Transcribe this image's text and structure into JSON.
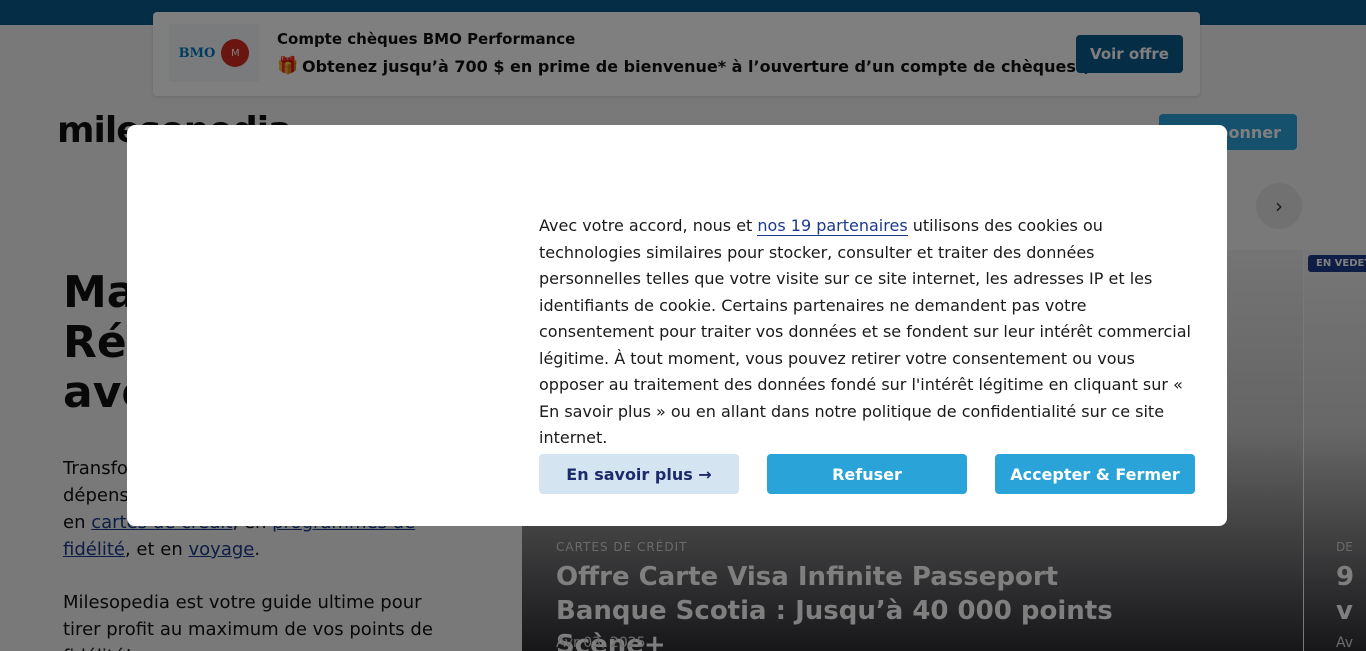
{
  "promo": {
    "logo_text": "BMO",
    "logo_mark": "M",
    "title": "Compte chèques BMO Performance",
    "text": "Obtenez jusqu’à 700 $ en prime de bienvenue* à l’ouverture d’un compte de chèques.†",
    "button": "Voir offre"
  },
  "header": {
    "logo": "milesopedia",
    "subscribe_label": "S'abonner"
  },
  "hero": {
    "title_lines": [
      "Ma",
      "Réa",
      "ave"
    ],
    "p1_start": "Transfo",
    "p1_line2": "dépens",
    "p1_line3_prefix": "en ",
    "link_cartes": "cartes de crédit",
    "p1_sep": ", en ",
    "link_programmes": "programmes de fidélité",
    "p1_mid": ", et en ",
    "link_voyage": "voyage",
    "p1_end": ".",
    "p2": "Milesopedia est votre guide ultime pour tirer profit au maximum de vos points de fidélité!"
  },
  "featured": {
    "badge": "EN VEDETTE",
    "category": "CARTES DE CRÉDIT",
    "title": "Offre Carte Visa Infinite Passeport Banque Scotia : Jusqu’à 40 000 points Scène+",
    "date": "Avr 03, 2025"
  },
  "next_card": {
    "category": "DE",
    "title_line1": "9",
    "title_line2": "v",
    "date": "Av"
  },
  "consent": {
    "text_before": "Avec votre accord, nous et ",
    "partners_link": "nos 19 partenaires",
    "text_after": " utilisons des cookies ou technologies similaires pour stocker, consulter et traiter des données personnelles telles que votre visite sur ce site internet, les adresses IP et les identifiants de cookie. Certains partenaires ne demandent pas votre consentement pour traiter vos données et se fondent sur leur intérêt commercial légitime. À tout moment, vous pouvez retirer votre consentement ou vous opposer au traitement des données fondé sur l'intérêt légitime en cliquant sur « En savoir plus » ou en allant dans notre politique de confidentialité sur ce site internet.",
    "learn_more": "En savoir plus →",
    "refuse": "Refuser",
    "accept": "Accepter & Fermer"
  },
  "icons": {
    "gift": "gift-icon",
    "search": "search-icon",
    "chevron": "chevron-right-icon"
  },
  "colors": {
    "brand_dark": "#0a5a8a",
    "brand_light": "#2aa3d8",
    "link": "#1b3a8a",
    "learn_more_bg": "#d4e4f1"
  }
}
